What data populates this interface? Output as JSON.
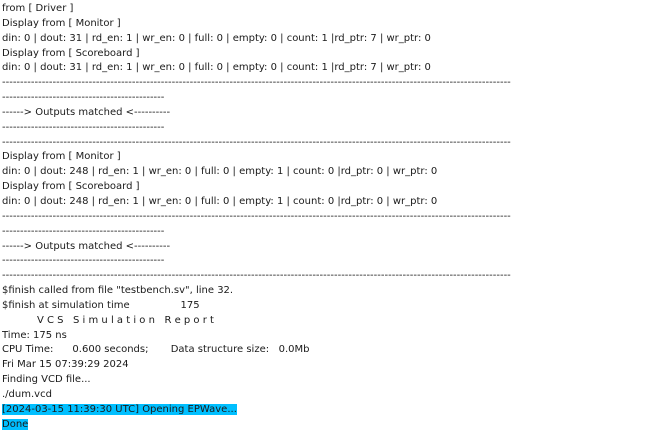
{
  "console": {
    "lines": [
      "from [ Driver ]",
      "Display from [ Monitor ]",
      "din: 0 | dout: 31 | rd_en: 1 | wr_en: 0 | full: 0 | empty: 0 | count: 1 |rd_ptr: 7 | wr_ptr: 0",
      "Display from [ Scoreboard ]",
      "din: 0 | dout: 31 | rd_en: 1 | wr_en: 0 | full: 0 | empty: 0 | count: 1 |rd_ptr: 7 | wr_ptr: 0",
      "---------------------------------------------------------------------------------------------------------------------------------------------",
      "---------------------------------------------",
      "------> Outputs matched <----------",
      "---------------------------------------------",
      "---------------------------------------------------------------------------------------------------------------------------------------------",
      "Display from [ Monitor ]",
      "din: 0 | dout: 248 | rd_en: 1 | wr_en: 0 | full: 0 | empty: 1 | count: 0 |rd_ptr: 0 | wr_ptr: 0",
      "Display from [ Scoreboard ]",
      "din: 0 | dout: 248 | rd_en: 1 | wr_en: 0 | full: 0 | empty: 1 | count: 0 |rd_ptr: 0 | wr_ptr: 0",
      "---------------------------------------------------------------------------------------------------------------------------------------------",
      "---------------------------------------------",
      "------> Outputs matched <----------",
      "---------------------------------------------",
      "---------------------------------------------------------------------------------------------------------------------------------------------",
      "$finish called from file \"testbench.sv\", line 32.",
      "$finish at simulation time                175",
      "           V C S   S i m u l a t i o n   R e p o r t",
      "Time: 175 ns",
      "CPU Time:      0.600 seconds;       Data structure size:   0.0Mb",
      "Fri Mar 15 07:39:29 2024",
      "Finding VCD file...",
      "./dum.vcd"
    ],
    "highlight_lines": [
      "[2024-03-15 11:39:30 UTC] Opening EPWave...",
      "Done"
    ],
    "highlight_color": "#00bfff"
  }
}
